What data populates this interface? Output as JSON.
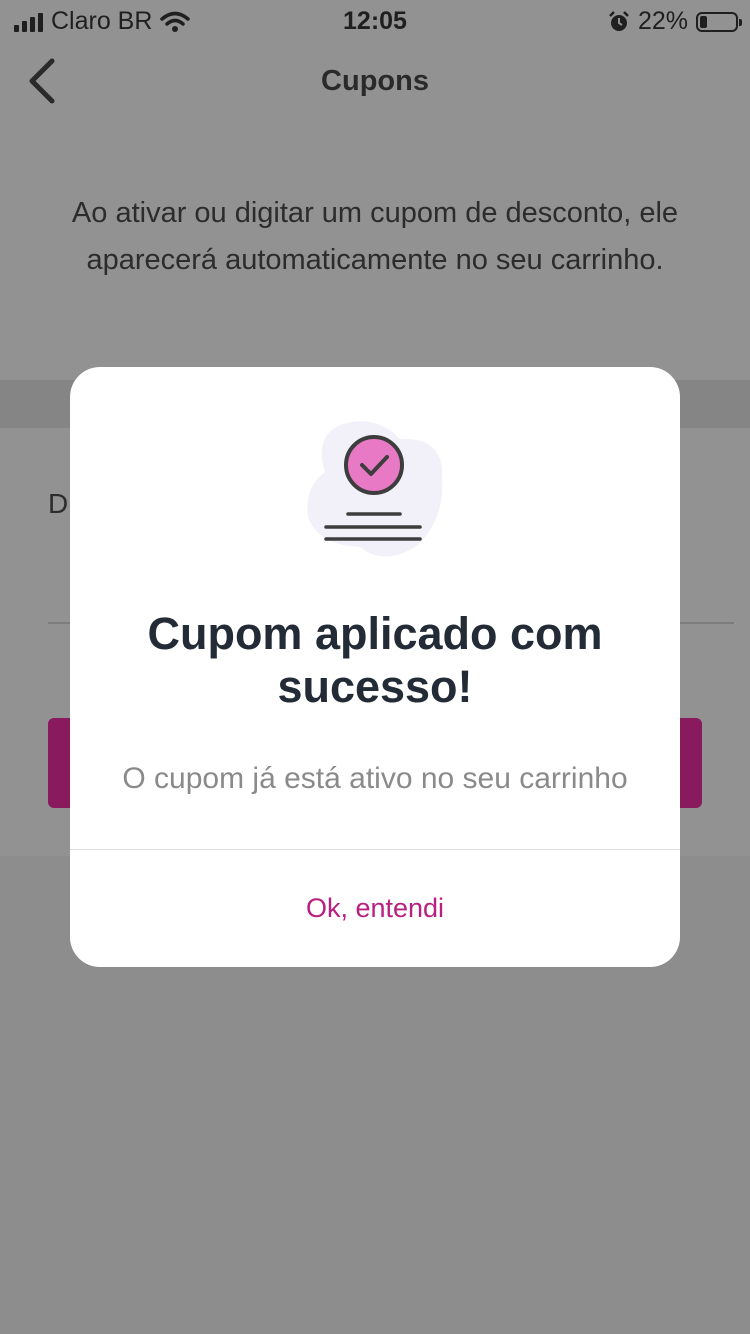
{
  "status_bar": {
    "carrier": "Claro BR",
    "time": "12:05",
    "battery": "22%",
    "battery_level": 0.22,
    "icons": [
      "signal-icon",
      "wifi-icon",
      "alarm-icon",
      "battery-icon"
    ]
  },
  "header": {
    "title": "Cupons",
    "back_icon": "chevron-left-icon"
  },
  "intro_text": "Ao ativar ou digitar um cupom de desconto, ele aparecerá automaticamente no seu carrinho.",
  "field_label_partial": "D",
  "colors": {
    "accent": "#b8207f",
    "apply_button": "#8a1a5e",
    "illustration_pink": "#e879c4",
    "title_text": "#232b36"
  },
  "modal": {
    "illustration_icon": "coupon-check-icon",
    "title": "Cupom aplicado com sucesso!",
    "subtitle": "O cupom já está ativo no seu carrinho",
    "button_label": "Ok, entendi"
  }
}
